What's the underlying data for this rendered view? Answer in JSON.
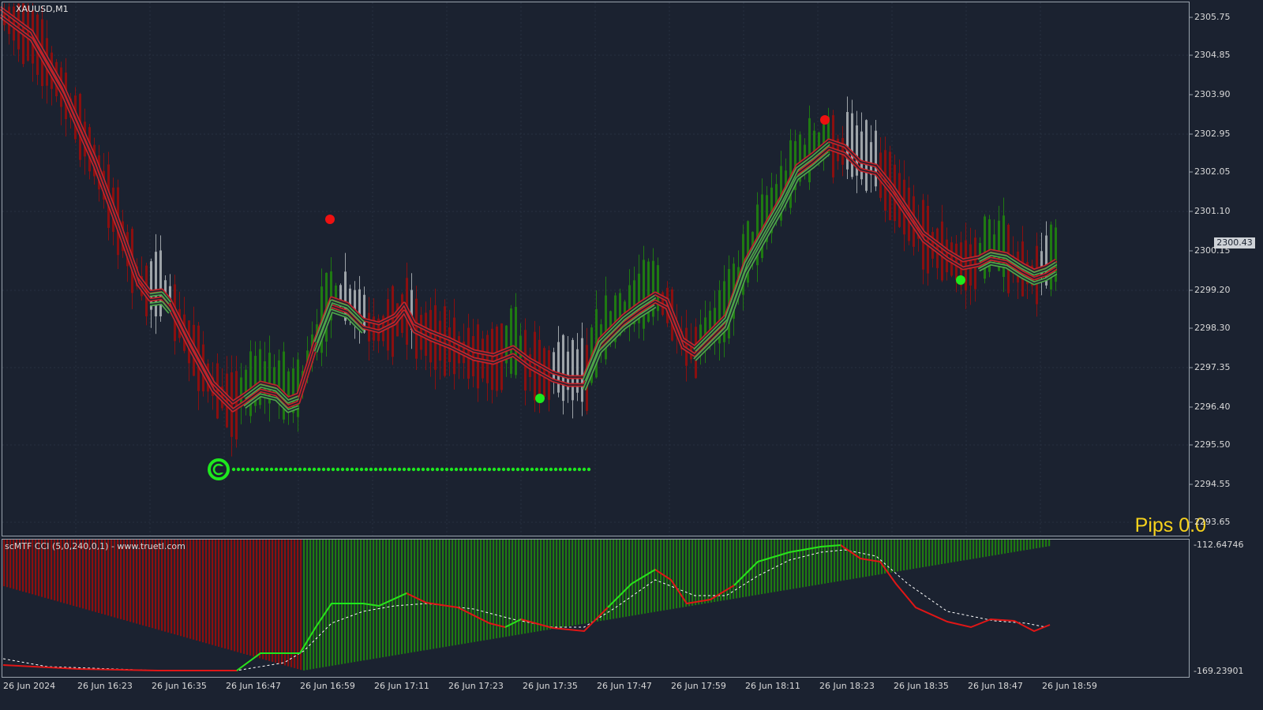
{
  "chart": {
    "symbol_label": "XAUUSD,M1",
    "indicator_label": "scMTF CCI (5,0,240,0,1) - www.truetl.com",
    "pips_label": "Pips 0.0",
    "current_price": "2300.43",
    "price_axis": [
      "2305.75",
      "2304.85",
      "2303.90",
      "2302.95",
      "2302.05",
      "2301.10",
      "2300.15",
      "2299.20",
      "2298.30",
      "2297.35",
      "2296.40",
      "2295.50",
      "2294.55",
      "2293.65"
    ],
    "indicator_axis": [
      "-112.64746",
      "-169.23901"
    ],
    "time_axis": [
      "26 Jun 2024",
      "26 Jun 16:23",
      "26 Jun 16:35",
      "26 Jun 16:47",
      "26 Jun 16:59",
      "26 Jun 17:11",
      "26 Jun 17:23",
      "26 Jun 17:35",
      "26 Jun 17:47",
      "26 Jun 17:59",
      "26 Jun 18:11",
      "26 Jun 18:23",
      "26 Jun 18:35",
      "26 Jun 18:47",
      "26 Jun 18:59"
    ],
    "colors": {
      "background": "#1b2230",
      "bull": "#1f7a12",
      "bear": "#8b0f0f",
      "neutral": "#9da3a8",
      "ma_red": "#c0242b",
      "ma_green": "#4ea34a",
      "signal_green": "#1ee81e",
      "signal_red": "#ee1111",
      "cci_green": "#1ee81e",
      "cci_red": "#e01616",
      "pips_text": "#f7d21c"
    },
    "icons": [
      "copyright-c-icon"
    ]
  }
}
